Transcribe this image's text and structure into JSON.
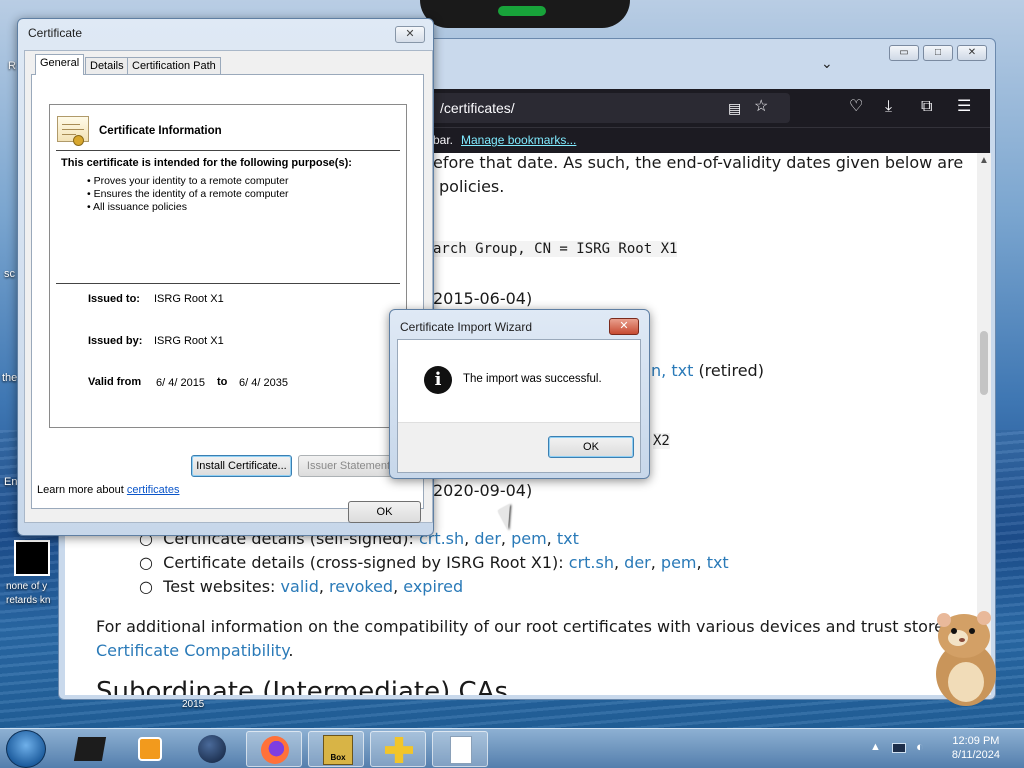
{
  "desktop": {
    "icons": [
      {
        "label": "R",
        "icon": "recycle-bin-icon"
      },
      {
        "label": "sc",
        "icon": "shortcut-icon"
      },
      {
        "label": "the",
        "icon": "file-icon"
      },
      {
        "label": "En",
        "icon": "file-icon"
      },
      {
        "label": "none of y\nretards kn",
        "icon": "black-file-icon"
      }
    ],
    "under_firefox_label": "2015"
  },
  "firefox": {
    "url": "/certificates/",
    "bookmarks_bar": {
      "text": "bar.",
      "link": "Manage bookmarks..."
    },
    "page": {
      "lines": [
        {
          "text": "efore that date. As such, the end-of-validity dates given below are"
        },
        {
          "text": "policies."
        }
      ],
      "dn_line": "arch Group, CN = ISRG Root X1",
      "date1": "2015-06-04)",
      "txt_link": "txt",
      "retired": "(retired)",
      "n_fragment": "n,",
      "x2_fragment": "X2",
      "date2": "2020-09-04)",
      "bullet_selfsigned": {
        "label": "Certificate details (self-signed):",
        "links": [
          "crt.sh",
          "der",
          "pem",
          "txt"
        ]
      },
      "bullet_crosssigned": {
        "label": "Certificate details (cross-signed by ISRG Root X1):",
        "links": [
          "crt.sh",
          "der",
          "pem",
          "txt"
        ]
      },
      "bullet_tests": {
        "label": "Test websites:",
        "links": [
          "valid",
          "revoked",
          "expired"
        ]
      },
      "para1": "For additional information on the compatibility of our root certificates with various devices and trust stores, see",
      "para_link": "Certificate Compatibility",
      "para_end": ".",
      "heading_partial": "Subordinate (Intermediate) CAs"
    }
  },
  "certificate_window": {
    "title": "Certificate",
    "close": "✕",
    "tabs": [
      "General",
      "Details",
      "Certification Path"
    ],
    "info_title": "Certificate Information",
    "purpose_heading": "This certificate is intended for the following purpose(s):",
    "purposes": [
      "Proves your identity to a remote computer",
      "Ensures the identity of a remote computer",
      "All issuance policies"
    ],
    "issued_to_label": "Issued to:",
    "issued_to": "ISRG Root X1",
    "issued_by_label": "Issued by:",
    "issued_by": "ISRG Root X1",
    "valid_from_label": "Valid from",
    "valid_from": "6/ 4/ 2015",
    "to_label": "to",
    "valid_to": "6/ 4/ 2035",
    "install_button": "Install Certificate...",
    "issuer_button": "Issuer Statement",
    "learn_more_text": "Learn more about",
    "learn_more_link": "certificates",
    "ok_button": "OK"
  },
  "wizard": {
    "title": "Certificate Import Wizard",
    "close": "✕",
    "message": "The import was successful.",
    "ok_button": "OK"
  },
  "taskbar": {
    "time": "12:09 PM",
    "date": "8/11/2024",
    "app_icons": [
      "start-orb-icon",
      "dark-box-icon",
      "media-player-icon",
      "globe-icon",
      "firefox-icon",
      "boxed-game-icon",
      "folder-arrows-icon",
      "document-icon"
    ],
    "box_label": "Box"
  }
}
